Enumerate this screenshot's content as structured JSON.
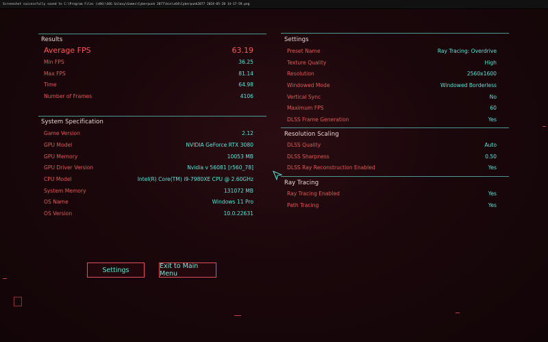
{
  "topbar": {
    "text": "Screenshot successfully saved to C:\\Program Files (x86)\\GOG Galaxy\\Games\\Cyberpunk 2077\\bin\\x64\\Cyberpunk2077 2024-05-28 14-17-59.png"
  },
  "results": {
    "title": "Results",
    "average_fps": {
      "label": "Average FPS",
      "value": "63.19"
    },
    "rows": [
      {
        "label": "Min FPS",
        "value": "36.25"
      },
      {
        "label": "Max FPS",
        "value": "81.14"
      },
      {
        "label": "Time",
        "value": "64.98"
      },
      {
        "label": "Number of Frames",
        "value": "4106"
      }
    ]
  },
  "system": {
    "title": "System Specification",
    "rows": [
      {
        "label": "Game Version",
        "value": "2.12"
      },
      {
        "label": "GPU Model",
        "value": "NVIDIA GeForce RTX 3080"
      },
      {
        "label": "GPU Memory",
        "value": "10053 MB"
      },
      {
        "label": "GPU Driver Version",
        "value": "Nvidia v 56081 [r560_78]"
      },
      {
        "label": "CPU Model",
        "value": "Intel(R) Core(TM) i9-7980XE CPU @ 2.60GHz"
      },
      {
        "label": "System Memory",
        "value": "131072 MB"
      },
      {
        "label": "OS Name",
        "value": "Windows 11 Pro"
      },
      {
        "label": "OS Version",
        "value": "10.0.22631"
      }
    ]
  },
  "settings": {
    "title": "Settings",
    "rows": [
      {
        "label": "Preset Name",
        "value": "Ray Tracing: Overdrive"
      },
      {
        "label": "Texture Quality",
        "value": "High"
      },
      {
        "label": "Resolution",
        "value": "2560x1600"
      },
      {
        "label": "Windowed Mode",
        "value": "Windowed Borderless"
      },
      {
        "label": "Vertical Sync",
        "value": "No"
      },
      {
        "label": "Maximum FPS",
        "value": "60"
      },
      {
        "label": "DLSS Frame Generation",
        "value": "Yes"
      }
    ]
  },
  "scaling": {
    "title": "Resolution Scaling",
    "rows": [
      {
        "label": "DLSS Quality",
        "value": "Auto"
      },
      {
        "label": "DLSS Sharpness",
        "value": "0.50"
      },
      {
        "label": "DLSS Ray Reconstruction Enabled",
        "value": "Yes"
      }
    ]
  },
  "raytracing": {
    "title": "Ray Tracing",
    "rows": [
      {
        "label": "Ray Tracing Enabled",
        "value": "Yes"
      },
      {
        "label": "Path Tracing",
        "value": "Yes"
      }
    ]
  },
  "buttons": {
    "settings": "Settings",
    "exit": "Exit to Main Menu"
  },
  "colors": {
    "label": "#e15b56",
    "value": "#58e6da",
    "accent_line": "#5fd9d0",
    "button_border": "#e0525a"
  }
}
